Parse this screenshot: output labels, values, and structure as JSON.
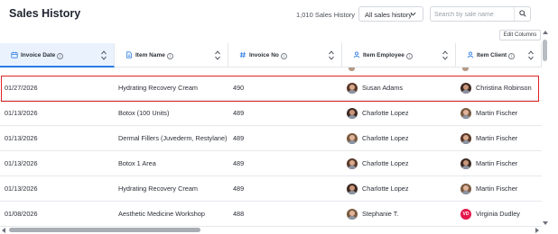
{
  "header": {
    "title": "Sales History",
    "count": "1,010 Sales History",
    "filter": {
      "selected": "All sales history"
    },
    "search": {
      "placeholder": "Search by sale name",
      "value": ""
    },
    "edit_columns_label": "Edit Columns"
  },
  "table": {
    "columns": [
      {
        "label": "Invoice Date",
        "icon": "calendar-icon",
        "info_glyph": "i",
        "sorted": true
      },
      {
        "label": "Item Name",
        "icon": "document-icon",
        "info_glyph": "i",
        "sorted": false
      },
      {
        "label": "Invoice No",
        "icon": "hash-icon",
        "info_glyph": "i",
        "sorted": false
      },
      {
        "label": "Item Employee",
        "icon": "person-icon",
        "info_glyph": "i",
        "sorted": false
      },
      {
        "label": "Item Client",
        "icon": "person-icon",
        "info_glyph": "i",
        "sorted": false
      }
    ],
    "rows": [
      {
        "date": "01/27/2026",
        "item": "Hydrating Recovery Cream",
        "invoice": "490",
        "employee": "Susan Adams",
        "employee_avatar": "photo",
        "client": "Christina Robinson",
        "client_avatar": "photo",
        "highlighted": true
      },
      {
        "date": "01/13/2026",
        "item": "Botox (100 Units)",
        "invoice": "489",
        "employee": "Charlotte Lopez",
        "employee_avatar": "photo",
        "client": "Martin Fischer",
        "client_avatar": "photo",
        "highlighted": false
      },
      {
        "date": "01/13/2026",
        "item": "Dermal Fillers (Juvederm, Restylane)",
        "invoice": "489",
        "employee": "Charlotte Lopez",
        "employee_avatar": "photo",
        "client": "Martin Fischer",
        "client_avatar": "photo",
        "highlighted": false
      },
      {
        "date": "01/13/2026",
        "item": "Botox 1 Area",
        "invoice": "489",
        "employee": "Charlotte Lopez",
        "employee_avatar": "photo",
        "client": "Martin Fischer",
        "client_avatar": "photo",
        "highlighted": false
      },
      {
        "date": "01/13/2026",
        "item": "Hydrating Recovery Cream",
        "invoice": "489",
        "employee": "Charlotte Lopez",
        "employee_avatar": "photo",
        "client": "Martin Fischer",
        "client_avatar": "photo",
        "highlighted": false
      },
      {
        "date": "01/08/2026",
        "item": "Aesthetic Medicine Workshop",
        "invoice": "488",
        "employee": "Stephanie T.",
        "employee_avatar": "photo",
        "client": "Virginia Dudley",
        "client_avatar": "initials",
        "client_initials": "VD",
        "highlighted": false
      }
    ]
  },
  "colors": {
    "accent": "#2c7be5",
    "highlight_border": "#e02424",
    "initials_badge": "#e5174a"
  }
}
